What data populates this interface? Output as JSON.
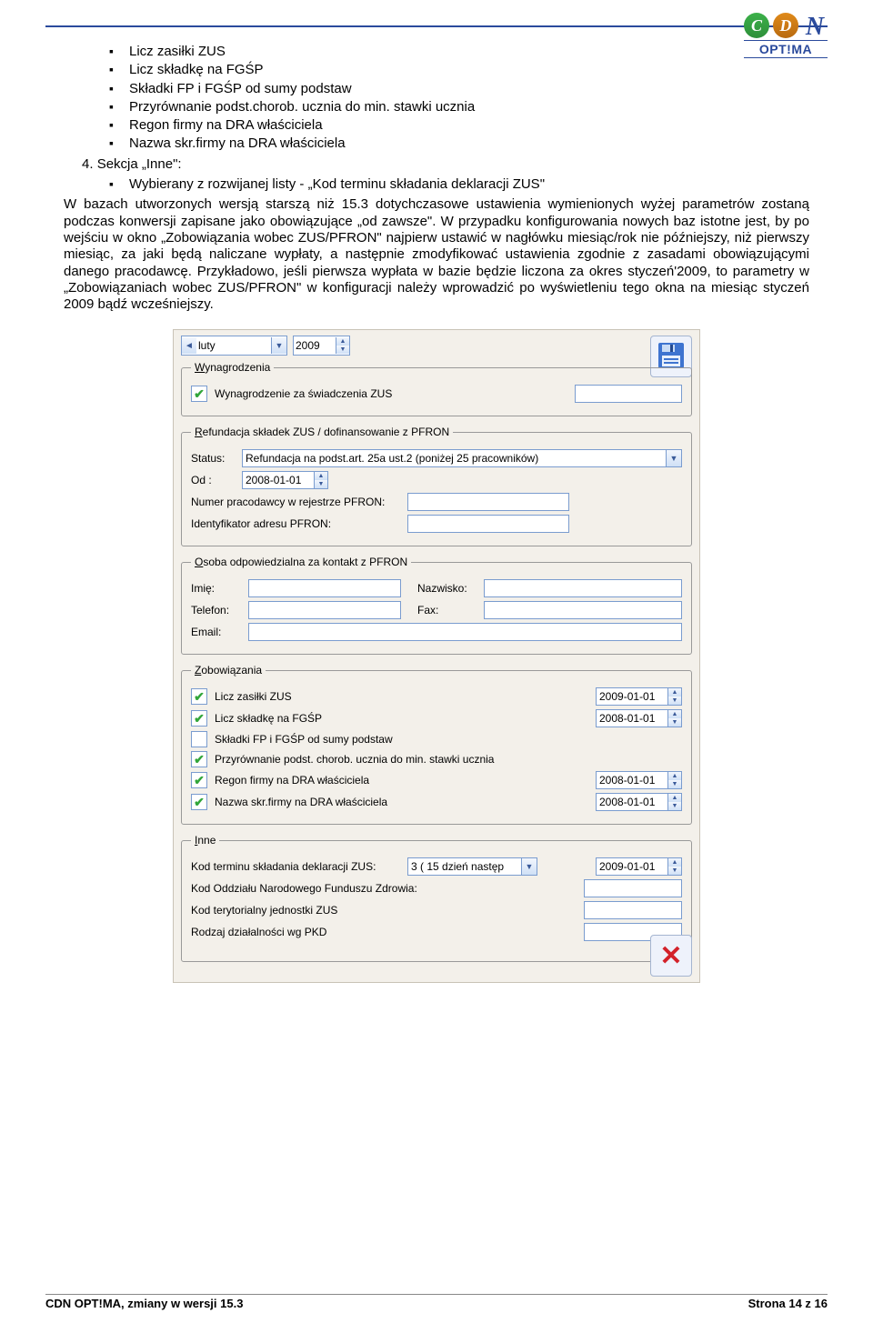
{
  "logo": {
    "letters": [
      "C",
      "D",
      "N"
    ],
    "sub": "OPT!MA"
  },
  "bullets": [
    "Licz zasiłki ZUS",
    "Licz składkę na FGŚP",
    "Składki FP i FGŚP od sumy podstaw",
    "Przyrównanie podst.chorob. ucznia do min. stawki ucznia",
    "Regon firmy na DRA właściciela",
    "Nazwa skr.firmy na DRA właściciela"
  ],
  "section": {
    "num": "4.",
    "title": "Sekcja „Inne\":",
    "item": "Wybierany z rozwijanej listy - „Kod terminu składania deklaracji ZUS\""
  },
  "paragraph": "W bazach utworzonych wersją starszą niż 15.3 dotychczasowe ustawienia wymienionych wyżej parametrów zostaną podczas konwersji zapisane jako obowiązujące „od zawsze\". W przypadku konfigurowania nowych baz istotne jest, by po wejściu w okno „Zobowiązania wobec ZUS/PFRON\" najpierw ustawić w nagłówku miesiąc/rok nie późniejszy, niż pierwszy miesiąc, za jaki będą naliczane wypłaty, a następnie zmodyfikować ustawienia zgodnie z zasadami obowiązującymi danego pracodawcę. Przykładowo, jeśli pierwsza wypłata w bazie będzie liczona za okres styczeń'2009, to parametry w „Zobowiązaniach wobec ZUS/PFRON\" w konfiguracji należy wprowadzić po wyświetleniu tego okna na miesiąc styczeń 2009 bądź wcześniejszy.",
  "form": {
    "month": "luty",
    "year": "2009",
    "group_wyn": {
      "legend_u": "W",
      "legend_rest": "ynagrodzenia",
      "chk1_checked": true,
      "chk1_label": "Wynagrodzenie za świadczenia ZUS",
      "val1": ""
    },
    "group_ref": {
      "legend_u": "R",
      "legend_rest": "efundacja składek ZUS / dofinansowanie z PFRON",
      "status_lbl": "Status:",
      "status_val": "Refundacja na podst.art. 25a ust.2 (poniżej 25 pracowników)",
      "od_lbl": "Od :",
      "od_val": "2008-01-01",
      "numer_lbl": "Numer pracodawcy w rejestrze PFRON:",
      "numer_val": "",
      "ident_lbl": "Identyfikator adresu PFRON:",
      "ident_val": ""
    },
    "group_osoba": {
      "legend_u": "O",
      "legend_rest": "soba odpowiedzialna za kontakt z PFRON",
      "imie_lbl": "Imię:",
      "imie_val": "",
      "nazw_lbl": "Nazwisko:",
      "nazw_val": "",
      "tel_lbl": "Telefon:",
      "tel_val": "",
      "fax_lbl": "Fax:",
      "fax_val": "",
      "email_lbl": "Email:",
      "email_val": ""
    },
    "group_zob": {
      "legend_u": "Z",
      "legend_rest": "obowiązania",
      "items": [
        {
          "checked": true,
          "label": "Licz zasiłki ZUS",
          "date": "2009-01-01"
        },
        {
          "checked": true,
          "label": "Licz składkę na FGŚP",
          "date": "2008-01-01"
        },
        {
          "checked": false,
          "label": "Składki FP i FGŚP od sumy podstaw",
          "date": ""
        },
        {
          "checked": true,
          "label": "Przyrównanie podst. chorob. ucznia do min. stawki ucznia",
          "date": ""
        },
        {
          "checked": true,
          "label": "Regon firmy na DRA właściciela",
          "date": "2008-01-01"
        },
        {
          "checked": true,
          "label": "Nazwa skr.firmy na DRA właściciela",
          "date": "2008-01-01"
        }
      ]
    },
    "group_inne": {
      "legend_u": "I",
      "legend_rest": "nne",
      "kodterm_lbl": "Kod terminu składania deklaracji ZUS:",
      "kodterm_val": "3 ( 15 dzień następ",
      "kodterm_date": "2009-01-01",
      "kod_oddz_lbl": "Kod Oddziału Narodowego Funduszu Zdrowia:",
      "kod_oddz_val": "",
      "kod_ter_lbl": "Kod terytorialny jednostki ZUS",
      "kod_ter_val": "",
      "rodz_lbl": "Rodzaj działalności wg PKD",
      "rodz_val": ""
    }
  },
  "footer": {
    "left": "CDN OPT!MA, zmiany w wersji 15.3",
    "right": "Strona 14 z 16"
  }
}
